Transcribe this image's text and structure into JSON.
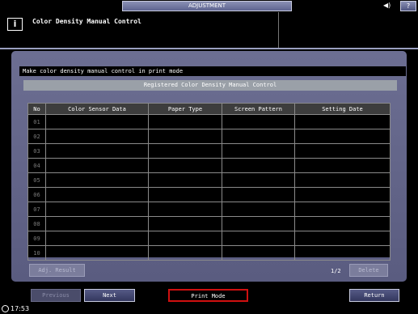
{
  "topbar": {
    "tab_label": "ADJUSTMENT",
    "speaker_icon": "◀)",
    "help_label": "?"
  },
  "header": {
    "info_icon": "i",
    "title": "Color Density Manual Control"
  },
  "main": {
    "instruction": "Make color density manual control in print mode",
    "registered_title": "Registered Color Density Manual Control",
    "table": {
      "headers": [
        "No",
        "Color Sensor Data",
        "Paper Type",
        "Screen Pattern",
        "Setting Date"
      ],
      "rows": [
        {
          "no": "01",
          "sensor": "",
          "paper": "",
          "screen": "",
          "date": ""
        },
        {
          "no": "02",
          "sensor": "",
          "paper": "",
          "screen": "",
          "date": ""
        },
        {
          "no": "03",
          "sensor": "",
          "paper": "",
          "screen": "",
          "date": ""
        },
        {
          "no": "04",
          "sensor": "",
          "paper": "",
          "screen": "",
          "date": ""
        },
        {
          "no": "05",
          "sensor": "",
          "paper": "",
          "screen": "",
          "date": ""
        },
        {
          "no": "06",
          "sensor": "",
          "paper": "",
          "screen": "",
          "date": ""
        },
        {
          "no": "07",
          "sensor": "",
          "paper": "",
          "screen": "",
          "date": ""
        },
        {
          "no": "08",
          "sensor": "",
          "paper": "",
          "screen": "",
          "date": ""
        },
        {
          "no": "09",
          "sensor": "",
          "paper": "",
          "screen": "",
          "date": ""
        },
        {
          "no": "10",
          "sensor": "",
          "paper": "",
          "screen": "",
          "date": ""
        }
      ]
    },
    "adj_result_label": "Adj. Result",
    "page_indicator": "1/2",
    "delete_label": "Delete"
  },
  "bottom": {
    "previous_label": "Previous",
    "next_label": "Next",
    "print_mode_label": "Print Mode",
    "return_label": "Return"
  },
  "status": {
    "time": "17:53"
  }
}
